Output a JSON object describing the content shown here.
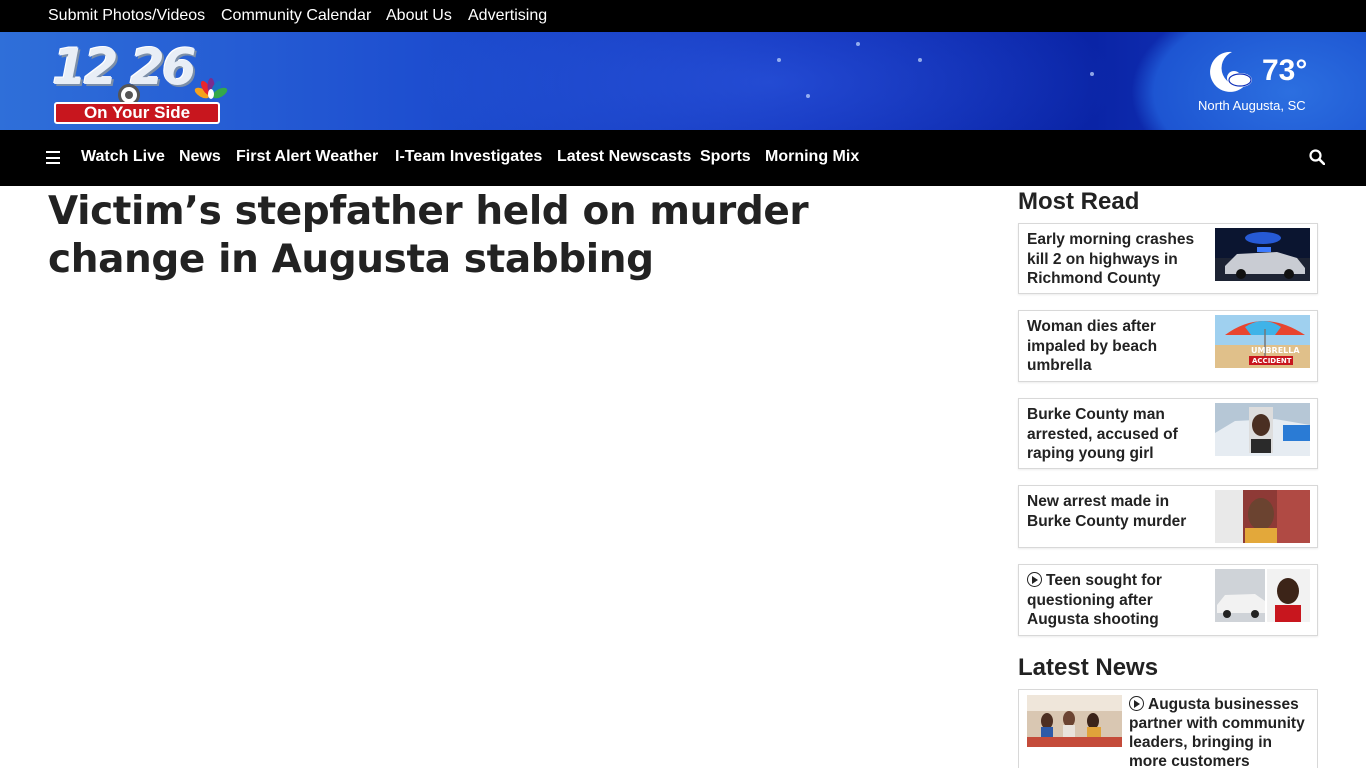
{
  "topbar": {
    "links": [
      "Submit Photos/Videos",
      "Community Calendar",
      "About Us",
      "Advertising"
    ]
  },
  "logo": {
    "number_text": "12 26",
    "tagline": "On Your Side"
  },
  "weather": {
    "temperature": "73°",
    "location": "North Augusta, SC",
    "icon": "moon-cloud-icon"
  },
  "nav": {
    "items": [
      "Watch Live",
      "News",
      "First Alert Weather",
      "I-Team Investigates",
      "Latest Newscasts",
      "Sports",
      "Morning Mix"
    ]
  },
  "article": {
    "headline": "Victim’s stepfather held on murder change in Augusta stabbing"
  },
  "most_read": {
    "title": "Most Read",
    "items": [
      {
        "title": "Early morning crashes kill 2 on highways in Richmond County",
        "video": false
      },
      {
        "title": "Woman dies after impaled by beach umbrella",
        "video": false,
        "thumb_text": [
          "UMBRELLA",
          "ACCIDENT"
        ]
      },
      {
        "title": "Burke County man arrested, accused of raping young girl",
        "video": false
      },
      {
        "title": "New arrest made in Burke County murder",
        "video": false
      },
      {
        "title": "Teen sought for questioning after Augusta shooting",
        "video": true
      }
    ]
  },
  "latest_news": {
    "title": "Latest News",
    "items": [
      {
        "title": "Augusta businesses partner with community leaders, bringing in more customers",
        "video": true
      }
    ]
  },
  "colors": {
    "topbar": "#000000",
    "header_blue": "#1e4fd0",
    "nav": "#000000",
    "logo_red": "#c8161e"
  }
}
